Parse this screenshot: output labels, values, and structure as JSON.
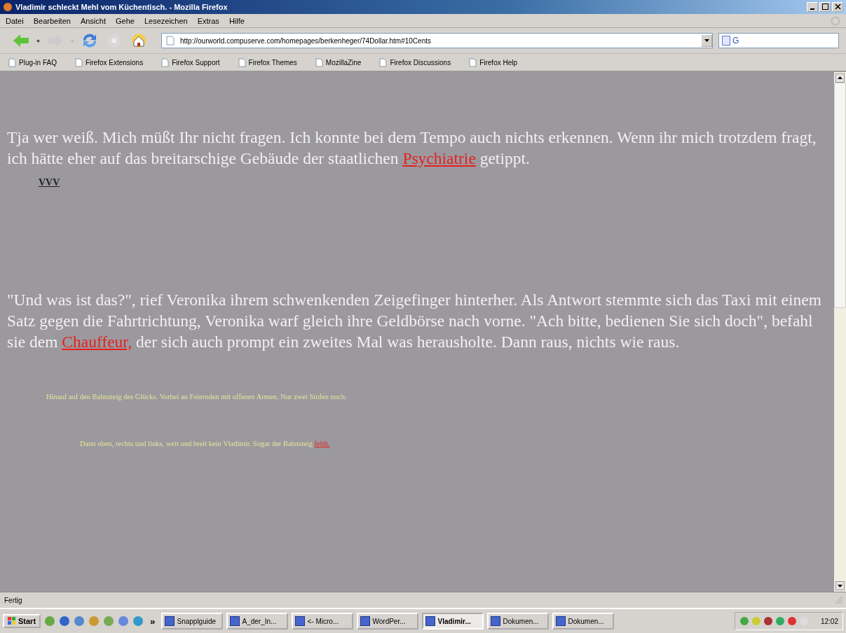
{
  "window": {
    "title": "Vladimir schleckt Mehl vom Küchentisch. - Mozilla Firefox"
  },
  "menu": [
    "Datei",
    "Bearbeiten",
    "Ansicht",
    "Gehe",
    "Lesezeichen",
    "Extras",
    "Hilfe"
  ],
  "address": {
    "value": "http://ourworld.compuserve.com/homepages/berkenheger/74Dollar.htm#10Cents"
  },
  "search": {
    "value": "G"
  },
  "bookmarks": [
    "Plug-in FAQ",
    "Firefox Extensions",
    "Firefox Support",
    "Firefox Themes",
    "MozillaZine",
    "Firefox Discussions",
    "Firefox Help"
  ],
  "content": [
    {
      "kind": "para",
      "segments": [
        {
          "kind": "text",
          "text": "Tja wer weiß. Mich müßt Ihr nicht fragen. Ich konnte bei dem Tempo auch nichts erkennen. Wenn ihr mich trotzdem fragt, ich hätte eher auf das breitarschige Gebäude der staatlichen "
        },
        {
          "kind": "link",
          "text": "Psychiatrie"
        },
        {
          "kind": "text",
          "text": " getippt."
        }
      ]
    },
    {
      "kind": "marker",
      "text": "VVV"
    },
    {
      "kind": "para",
      "segments": [
        {
          "kind": "text",
          "text": "\"Und was ist das?\", rief Veronika ihrem schwenkenden Zeigefinger hinterher. Als Antwort stemmte sich das Taxi mit einem Satz gegen die Fahrtrichtung, Veronika warf gleich ihre Geldbörse nach vorne. \"Ach bitte, bedienen Sie sich doch\", befahl sie dem "
        },
        {
          "kind": "link",
          "text": "Chauffeur,"
        },
        {
          "kind": "text",
          "text": " der sich auch prompt ein zweites Mal was herausholte. Dann raus, nichts wie raus."
        }
      ]
    },
    {
      "kind": "small",
      "segments": [
        {
          "kind": "text",
          "text": "Hinauf auf den Bahnsteig des Glücks. Vorbei an Feiernden mit offenen Armen. Nur zwei Stufen noch."
        }
      ]
    },
    {
      "kind": "small2",
      "segments": [
        {
          "kind": "text",
          "text": "Dann oben, rechts und links, weit und breit kein Vladimir. Sogar der Bahnsteig "
        },
        {
          "kind": "link",
          "text": "fehlt."
        }
      ]
    }
  ],
  "status_bar": {
    "text": "Fertig"
  },
  "taskbar": {
    "start": "Start",
    "more": "»",
    "tasks": [
      {
        "label": "Snapplguide",
        "selected": false
      },
      {
        "label": "A_der_In...",
        "selected": false
      },
      {
        "label": "<- Micro...",
        "selected": false
      },
      {
        "label": "WordPer...",
        "selected": false
      },
      {
        "label": "Vladimir...",
        "selected": true
      },
      {
        "label": "Dokumen...",
        "selected": false
      },
      {
        "label": "Dokumen...",
        "selected": false
      }
    ],
    "clock": "12:02"
  }
}
